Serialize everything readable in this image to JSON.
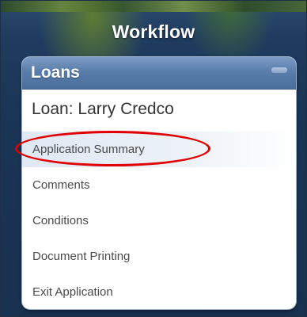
{
  "header": {
    "title": "Workflow"
  },
  "panel": {
    "label": "Loans",
    "loan_title": "Loan: Larry Credco",
    "items": [
      {
        "label": "Application Summary",
        "selected": true
      },
      {
        "label": "Comments",
        "selected": false
      },
      {
        "label": "Conditions",
        "selected": false
      },
      {
        "label": "Document Printing",
        "selected": false
      },
      {
        "label": "Exit Application",
        "selected": false
      }
    ]
  },
  "annotation": {
    "highlight_color": "#e00000",
    "highlighted_item": "Application Summary"
  },
  "icons": {
    "collapse": "collapse-icon"
  }
}
